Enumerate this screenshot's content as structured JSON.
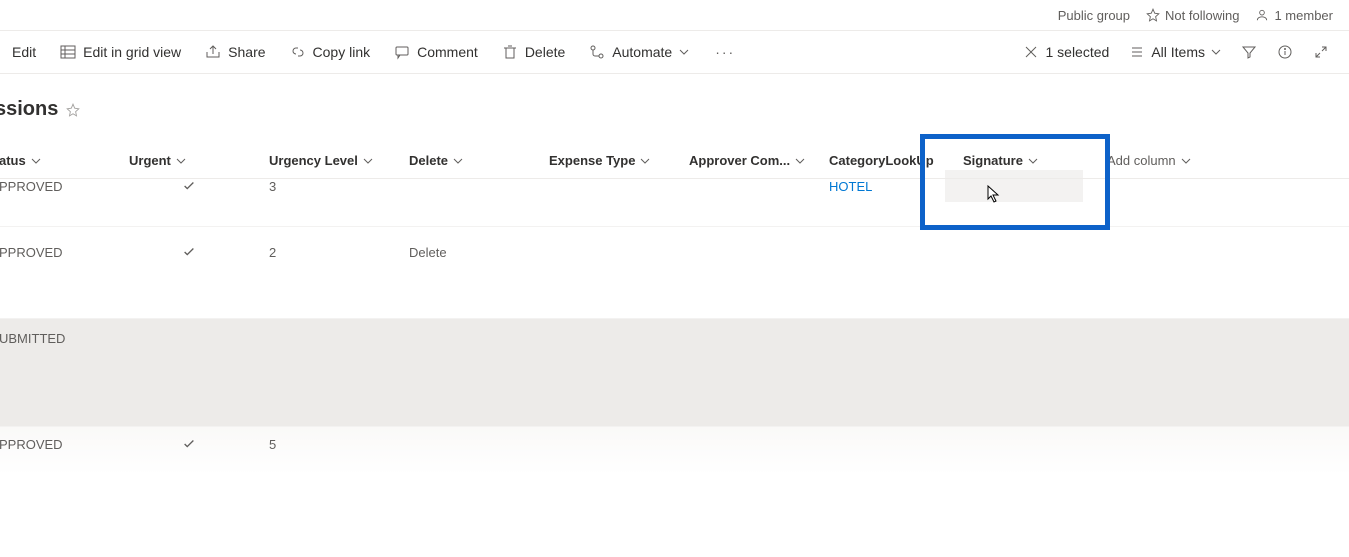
{
  "header": {
    "group": "Public group",
    "follow": "Not following",
    "members": "1 member"
  },
  "commands": {
    "edit": "Edit",
    "grid_view": "Edit in grid view",
    "share": "Share",
    "copy_link": "Copy link",
    "comment": "Comment",
    "delete": "Delete",
    "automate": "Automate"
  },
  "right_commands": {
    "selected": "1 selected",
    "all_items": "All Items"
  },
  "title": "ssions",
  "columns": {
    "status": "atus",
    "urgent": "Urgent",
    "urgency_level": "Urgency Level",
    "delete": "Delete",
    "expense_type": "Expense Type",
    "approver_com": "Approver Com...",
    "category_lookup": "CategoryLookUp",
    "signature": "Signature",
    "add_column": "Add column"
  },
  "rows": [
    {
      "status": "PPROVED",
      "urgent_check": true,
      "urgency_level": "3",
      "delete": "",
      "category": "HOTEL"
    },
    {
      "status": "PPROVED",
      "urgent_check": true,
      "urgency_level": "2",
      "delete": "Delete",
      "category": ""
    },
    {
      "status": "UBMITTED",
      "urgent_check": false,
      "urgency_level": "",
      "delete": "",
      "category": ""
    },
    {
      "status": "PPROVED",
      "urgent_check": true,
      "urgency_level": "5",
      "delete": "",
      "category": ""
    }
  ]
}
